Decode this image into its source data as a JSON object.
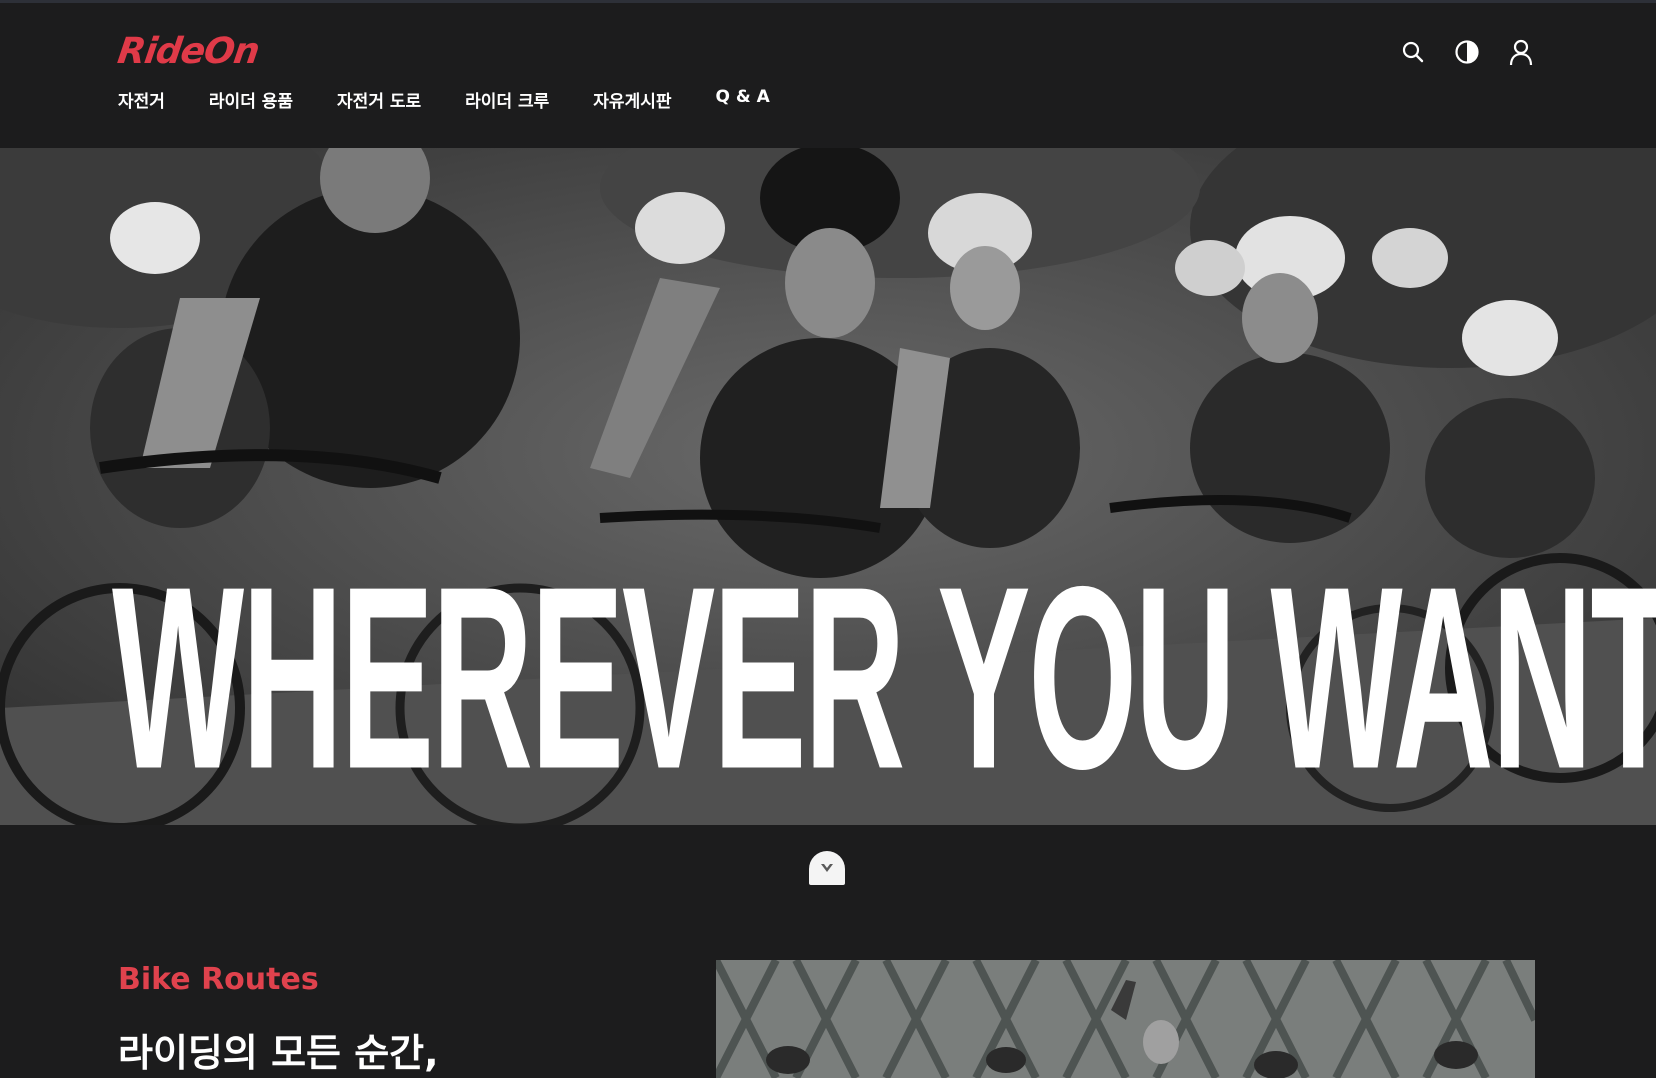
{
  "brand": {
    "logo_text": "RideOn",
    "accent": "#e03a48"
  },
  "nav": {
    "items": [
      {
        "label": "자전거"
      },
      {
        "label": "라이더 용품"
      },
      {
        "label": "자전거 도로"
      },
      {
        "label": "라이더 크루"
      },
      {
        "label": "자유게시판"
      },
      {
        "label": "Q & A"
      }
    ]
  },
  "header_icons": {
    "search": "search-icon",
    "theme": "contrast-icon",
    "user": "user-icon"
  },
  "hero": {
    "title": "WHEREVER YOU WANT",
    "image": "cyclists-peloton-photo"
  },
  "scroll_button": {
    "icon": "chevron-down-icon"
  },
  "section": {
    "label": "Bike Routes",
    "heading": "라이딩의 모든 순간,",
    "image": "cycling-crew-bridge-photo"
  },
  "colors": {
    "background": "#1c1c1d",
    "accent": "#e0424d",
    "text": "#ffffff"
  }
}
